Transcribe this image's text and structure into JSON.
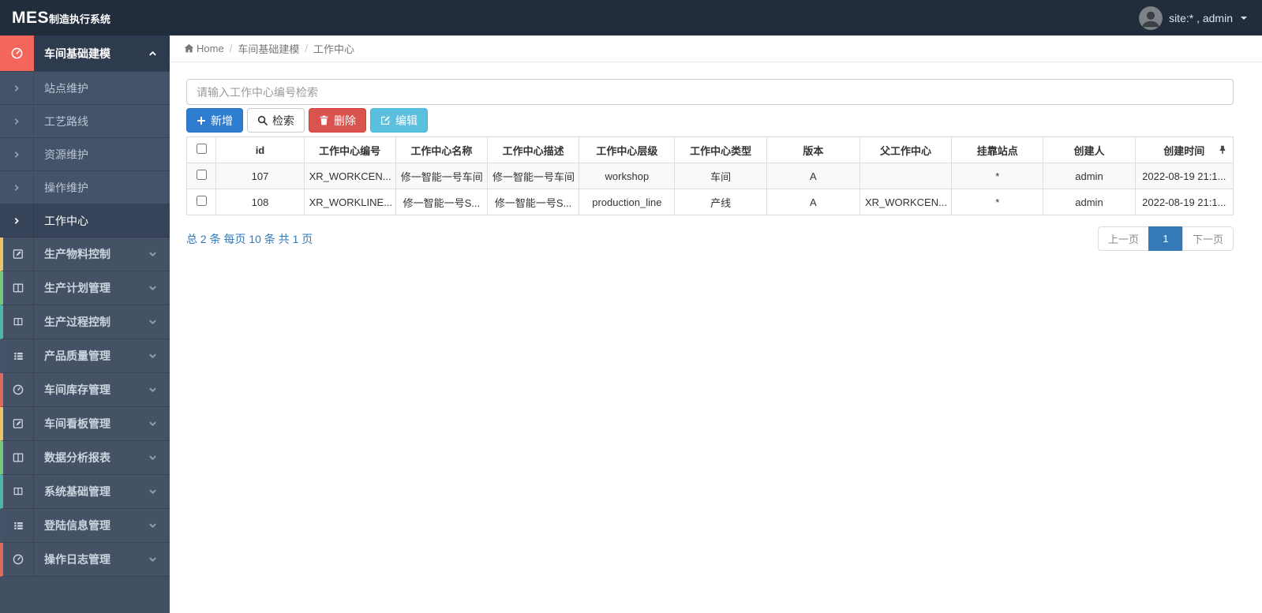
{
  "navbar": {
    "brand_bold": "MES",
    "brand_rest": "制造执行系统",
    "user_label": "site:* , admin"
  },
  "sidebar": {
    "group": {
      "label": "车间基础建模",
      "icon": "gauge-icon",
      "accent_color": "#f4655c",
      "expanded": true
    },
    "submenu": [
      {
        "label": "站点维护",
        "active": false
      },
      {
        "label": "工艺路线",
        "active": false
      },
      {
        "label": "资源维护",
        "active": false
      },
      {
        "label": "操作维护",
        "active": false
      },
      {
        "label": "工作中心",
        "active": true
      }
    ],
    "items": [
      {
        "label": "生产物料控制",
        "icon": "edit-icon",
        "stripe_color": "#e9c46a"
      },
      {
        "label": "生产计划管理",
        "icon": "columns-icon",
        "stripe_color": "#77c67f"
      },
      {
        "label": "生产过程控制",
        "icon": "book-icon",
        "stripe_color": "#4db6ac"
      },
      {
        "label": "产品质量管理",
        "icon": "list-icon",
        "stripe_color": "#44536a"
      },
      {
        "label": "车间库存管理",
        "icon": "gauge-icon",
        "stripe_color": "#e0685e"
      },
      {
        "label": "车间看板管理",
        "icon": "edit-icon",
        "stripe_color": "#e9c46a"
      },
      {
        "label": "数据分析报表",
        "icon": "columns-icon",
        "stripe_color": "#77c67f"
      },
      {
        "label": "系统基础管理",
        "icon": "book-icon",
        "stripe_color": "#4db6ac"
      },
      {
        "label": "登陆信息管理",
        "icon": "list-icon",
        "stripe_color": "#44536a"
      },
      {
        "label": "操作日志管理",
        "icon": "gauge-icon",
        "stripe_color": "#e0685e"
      }
    ]
  },
  "breadcrumb": {
    "items": [
      "Home",
      "车间基础建模",
      "工作中心"
    ],
    "separator": "/"
  },
  "toolbar": {
    "search_placeholder": "请输入工作中心编号检索",
    "search_value": "",
    "add_label": "新增",
    "query_label": "检索",
    "delete_label": "删除",
    "edit_label": "编辑"
  },
  "table": {
    "columns": [
      "id",
      "工作中心编号",
      "工作中心名称",
      "工作中心描述",
      "工作中心层级",
      "工作中心类型",
      "版本",
      "父工作中心",
      "挂靠站点",
      "创建人",
      "创建时间"
    ],
    "rows": [
      [
        "107",
        "XR_WORKCEN...",
        "修一智能一号车间",
        "修一智能一号车间",
        "workshop",
        "车间",
        "A",
        "",
        "*",
        "admin",
        "2022-08-19 21:1..."
      ],
      [
        "108",
        "XR_WORKLINE...",
        "修一智能一号S...",
        "修一智能一号S...",
        "production_line",
        "产线",
        "A",
        "XR_WORKCEN...",
        "*",
        "admin",
        "2022-08-19 21:1..."
      ]
    ]
  },
  "pagination": {
    "summary": "总 2 条 每页 10 条 共 1 页",
    "prev_label": "上一页",
    "page": "1",
    "next_label": "下一页"
  },
  "colors": {
    "navbar_bg": "#222d3c",
    "sidebar_bg": "#455266",
    "active_group_accent": "#f4655c",
    "primary_button": "#2e7dd1",
    "danger_button": "#d9534f",
    "info_button": "#5bc0de",
    "link_blue": "#337ab7"
  }
}
